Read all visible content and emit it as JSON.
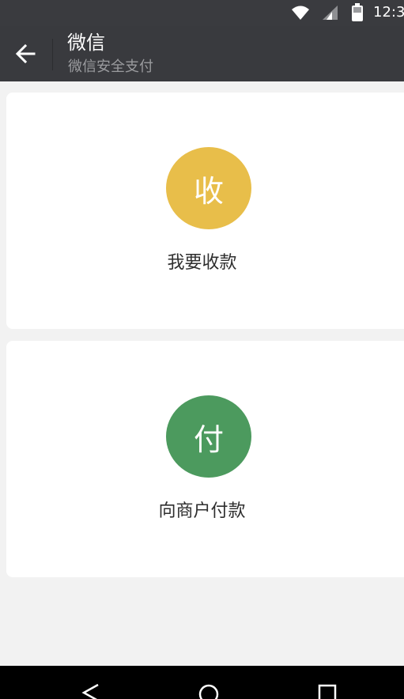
{
  "status_bar": {
    "time": "12:3",
    "icons": [
      "wifi-icon",
      "signal-icon",
      "battery-icon"
    ]
  },
  "action_bar": {
    "title": "微信",
    "subtitle": "微信安全支付",
    "back_icon": "arrow-left-icon"
  },
  "cards": {
    "collect": {
      "glyph": "收",
      "label": "我要收款",
      "color": "#e8be4a"
    },
    "pay": {
      "glyph": "付",
      "label": "向商户付款",
      "color": "#4c9a5e"
    }
  },
  "nav_bar": {
    "icons": [
      "back-triangle-icon",
      "home-circle-icon",
      "recent-square-icon"
    ]
  },
  "colors": {
    "action_bar": "#393a3e",
    "background": "#f2f2f2"
  }
}
